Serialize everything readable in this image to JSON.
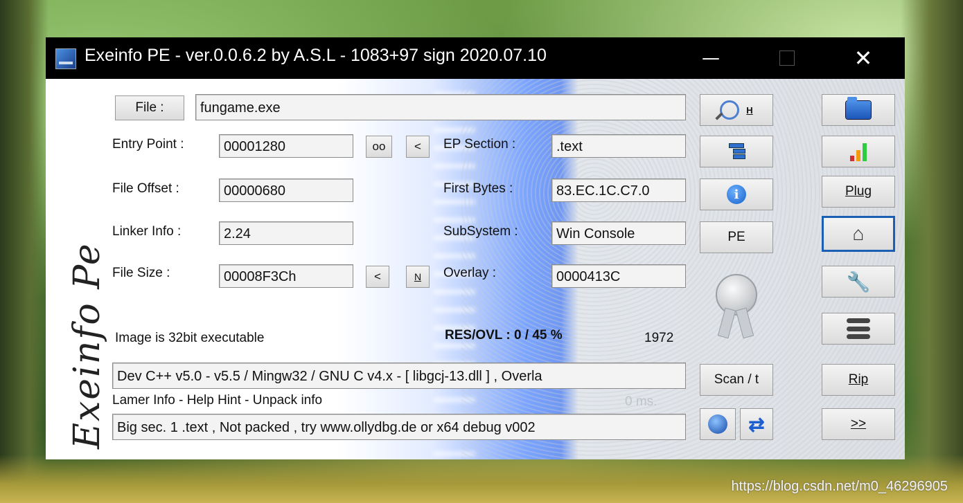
{
  "titlebar": {
    "title": "Exeinfo PE - ver.0.0.6.2  by A.S.L -  1083+97 sign  2020.07.10",
    "minimize": "—",
    "close": "✕"
  },
  "signature": "Exeinfo Pe",
  "file": {
    "button_label": "File :",
    "value": "fungame.exe"
  },
  "entry_point": {
    "label": "Entry Point :",
    "value": "00001280",
    "oo_label": "oo",
    "lt_label": "<"
  },
  "ep_section": {
    "label": "EP Section :",
    "value": ".text"
  },
  "file_offset": {
    "label": "File Offset :",
    "value": "00000680"
  },
  "first_bytes": {
    "label": "First Bytes :",
    "value": "83.EC.1C.C7.0"
  },
  "linker_info": {
    "label": "Linker Info :",
    "value": "2.24"
  },
  "subsystem": {
    "label": "SubSystem :",
    "value": "Win Console"
  },
  "file_size": {
    "label": "File Size :",
    "value": "00008F3Ch",
    "lt_label": "<",
    "n_label": "N"
  },
  "overlay": {
    "label": "Overlay :",
    "value": "0000413C"
  },
  "image_info": "Image is 32bit executable",
  "res_ovl": {
    "label": "RES/OVL : 0 / 45 %",
    "value": "1972"
  },
  "detect_result": "Dev C++ v5.0 - v5.5 / Mingw32 / GNU C v4.x - [ libgcj-13.dll ] , Overla",
  "lamer_info": "Lamer Info - Help Hint - Unpack info",
  "time_ms": "0 ms.",
  "hint_result": "Big sec. 1 .text , Not packed , try  www.ollydbg.de or x64 debug v002",
  "mid_buttons": {
    "h_label": "H",
    "pe_label": "PE",
    "scan_label": "Scan / t"
  },
  "right_buttons": {
    "plug_label": "Plug",
    "rip_label": "Rip",
    "next_label": ">>"
  },
  "colors": {
    "bar1": "#d32f2f",
    "bar2": "#f39c12",
    "bar3": "#2ecc40"
  },
  "watermark": "https://blog.csdn.net/m0_46296905"
}
